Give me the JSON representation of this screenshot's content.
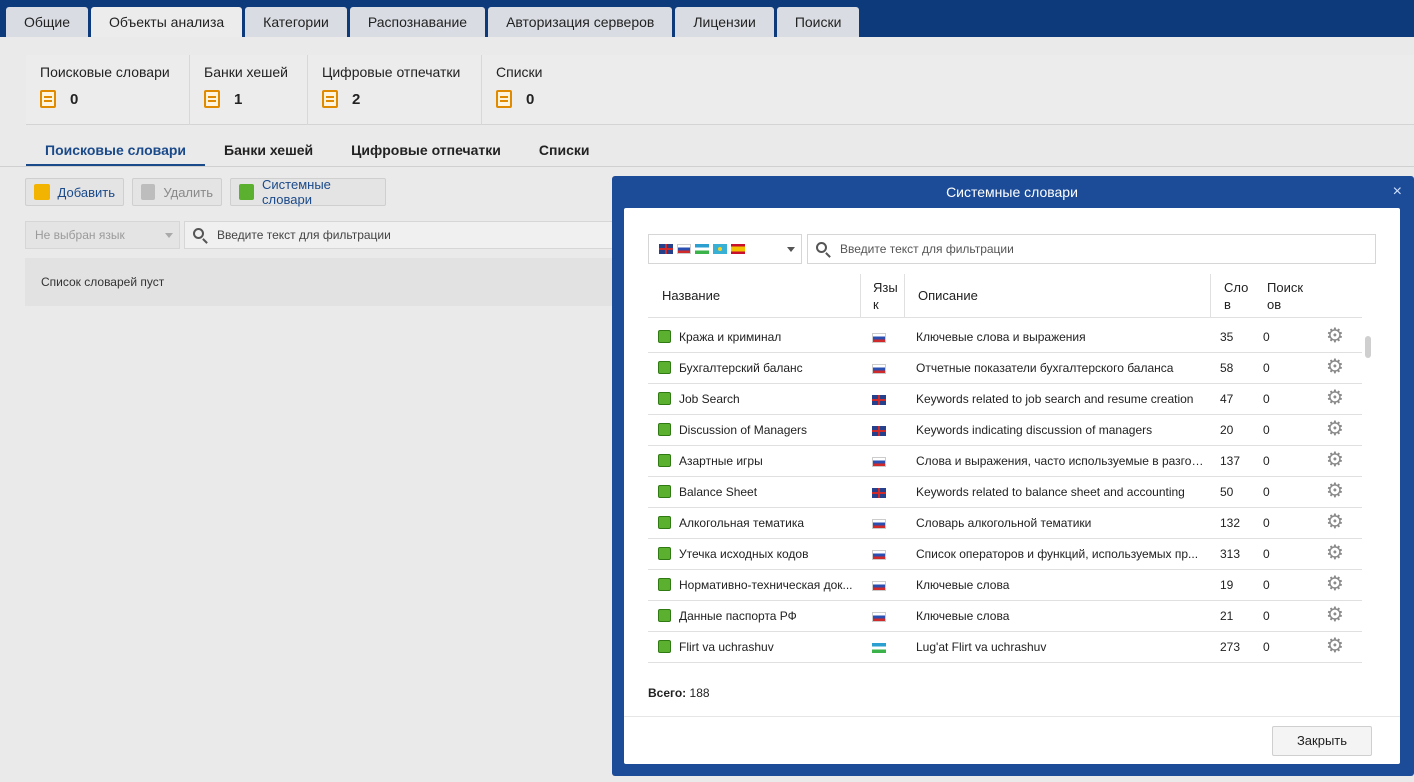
{
  "top_tabs": [
    {
      "label": "Общие"
    },
    {
      "label": "Объекты анализа"
    },
    {
      "label": "Категории"
    },
    {
      "label": "Распознавание"
    },
    {
      "label": "Авторизация серверов"
    },
    {
      "label": "Лицензии"
    },
    {
      "label": "Поиски"
    }
  ],
  "counters": [
    {
      "label": "Поисковые словари",
      "value": "0",
      "icon": "dictionary-icon"
    },
    {
      "label": "Банки хешей",
      "value": "1",
      "icon": "hash-bank-icon"
    },
    {
      "label": "Цифровые отпечатки",
      "value": "2",
      "icon": "fingerprint-icon"
    },
    {
      "label": "Списки",
      "value": "0",
      "icon": "list-icon"
    }
  ],
  "sub_tabs": [
    {
      "label": "Поисковые словари"
    },
    {
      "label": "Банки хешей"
    },
    {
      "label": "Цифровые отпечатки"
    },
    {
      "label": "Списки"
    }
  ],
  "toolbar": {
    "add_label": "Добавить",
    "delete_label": "Удалить",
    "system_label": "Системные словари"
  },
  "filters": {
    "lang_placeholder": "Не выбран язык",
    "text_placeholder": "Введите текст для фильтрации"
  },
  "empty_text": "Список словарей пуст",
  "modal": {
    "title": "Системные словари",
    "close_icon": "×",
    "filter_placeholder": "Введите текст для фильтрации",
    "flags": [
      "en",
      "ru",
      "uz",
      "kz",
      "es"
    ],
    "columns": {
      "name": "Название",
      "lang_1": "Язы",
      "lang_2": "к",
      "desc": "Описание",
      "words_1": "Сло",
      "words_2": "в",
      "search_1": "Поиск",
      "search_2": "ов"
    },
    "rows": [
      {
        "name": "Кража и криминал",
        "lang": "ru",
        "desc": "Ключевые слова и выражения",
        "words": "35",
        "searches": "0"
      },
      {
        "name": "Бухгалтерский баланс",
        "lang": "ru",
        "desc": "Отчетные показатели бухгалтерского баланса",
        "words": "58",
        "searches": "0"
      },
      {
        "name": "Job Search",
        "lang": "en",
        "desc": "Keywords related to job search and resume creation",
        "words": "47",
        "searches": "0"
      },
      {
        "name": "Discussion of Managers",
        "lang": "en",
        "desc": "Keywords indicating discussion of managers",
        "words": "20",
        "searches": "0"
      },
      {
        "name": "Азартные игры",
        "lang": "ru",
        "desc": "Слова и выражения, часто используемые в разгов...",
        "words": "137",
        "searches": "0"
      },
      {
        "name": "Balance Sheet",
        "lang": "en",
        "desc": "Keywords related to balance sheet and accounting",
        "words": "50",
        "searches": "0"
      },
      {
        "name": "Алкогольная тематика",
        "lang": "ru",
        "desc": "Словарь алкогольной тематики",
        "words": "132",
        "searches": "0"
      },
      {
        "name": "Утечка исходных кодов",
        "lang": "ru",
        "desc": "Список операторов и функций, используемых пр...",
        "words": "313",
        "searches": "0"
      },
      {
        "name": "Нормативно-техническая док...",
        "lang": "ru",
        "desc": "Ключевые слова",
        "words": "19",
        "searches": "0"
      },
      {
        "name": "Данные паспорта РФ",
        "lang": "ru",
        "desc": "Ключевые слова",
        "words": "21",
        "searches": "0"
      },
      {
        "name": "Flirt va uchrashuv",
        "lang": "uz",
        "desc": "Lug'at Flirt va uchrashuv",
        "words": "273",
        "searches": "0"
      }
    ],
    "total_label": "Всего:",
    "total_value": "188",
    "close_button": "Закрыть"
  }
}
